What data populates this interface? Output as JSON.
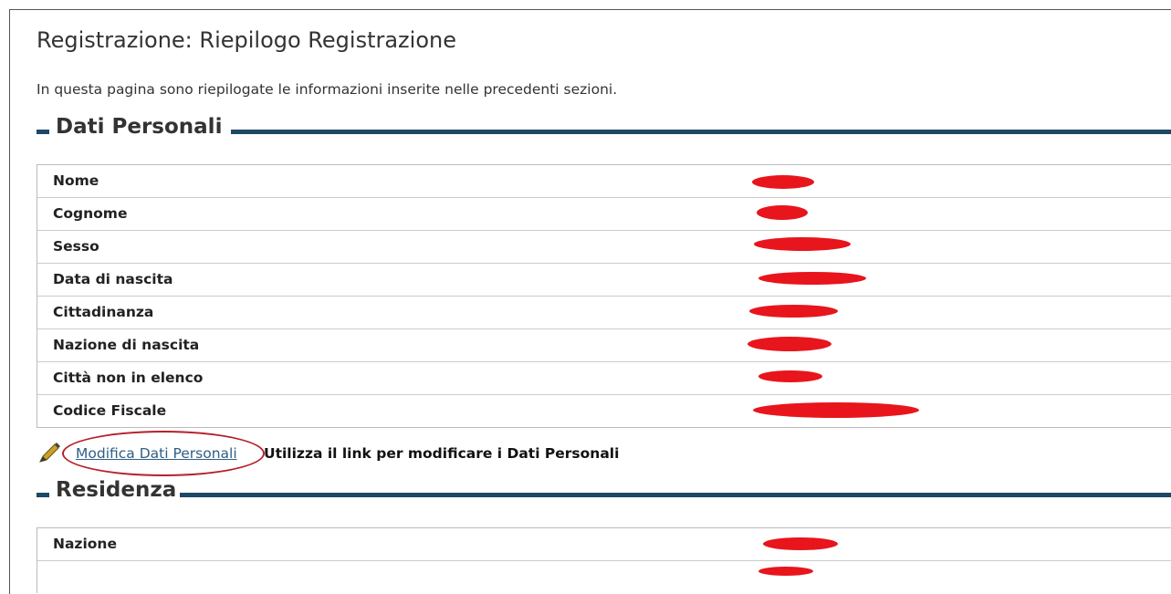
{
  "page": {
    "title": "Registrazione: Riepilogo Registrazione",
    "intro": "In questa pagina sono riepilogate le informazioni inserite nelle precedenti sezioni."
  },
  "dati_personali": {
    "heading": "Dati Personali",
    "rows": [
      {
        "label": "Nome"
      },
      {
        "label": "Cognome"
      },
      {
        "label": "Sesso"
      },
      {
        "label": "Data di nascita"
      },
      {
        "label": "Cittadinanza"
      },
      {
        "label": "Nazione di nascita"
      },
      {
        "label": "Città non in elenco"
      },
      {
        "label": "Codice Fiscale"
      }
    ],
    "edit_link": "Modifica Dati Personali",
    "edit_note": "Utilizza il link per modificare i Dati Personali"
  },
  "residenza": {
    "heading": "Residenza",
    "rows": [
      {
        "label": "Nazione"
      },
      {
        "label": ""
      }
    ]
  },
  "colors": {
    "section_rule": "#1d4866",
    "link": "#2f5f86",
    "redaction": "#e8151c",
    "highlight_circle": "#b5202c"
  },
  "icons": {
    "edit": "pencil-icon"
  }
}
